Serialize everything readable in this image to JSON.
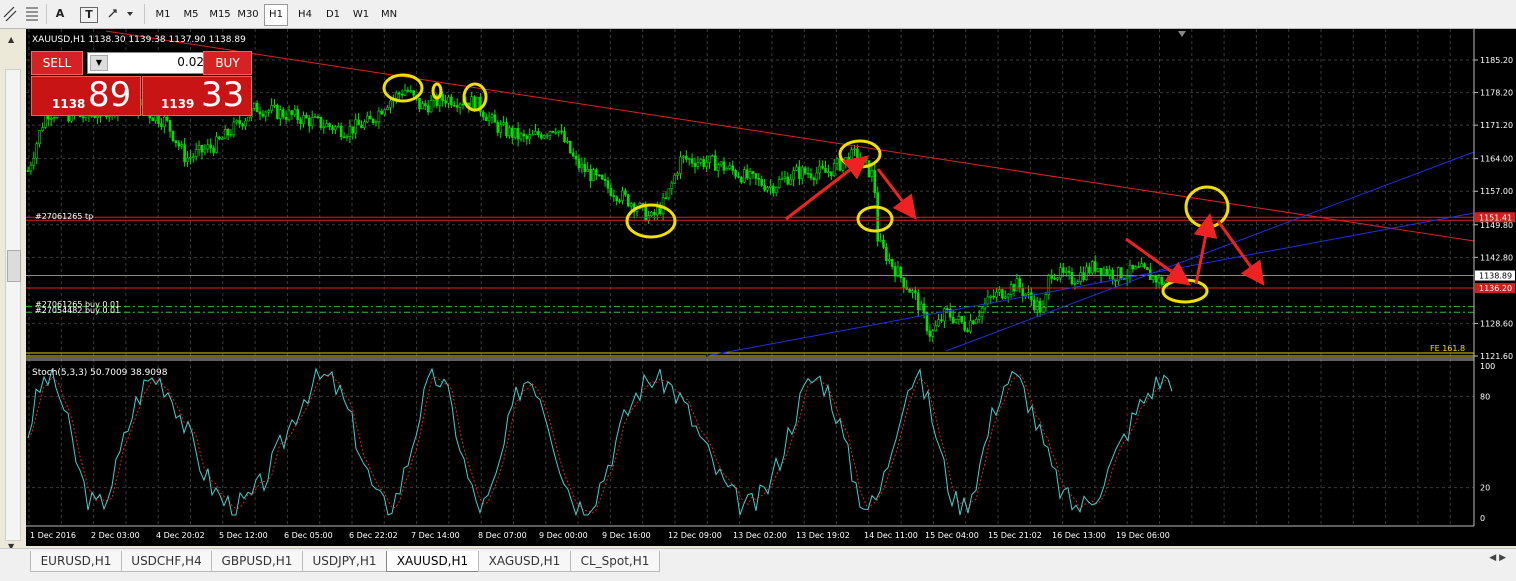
{
  "toolbar": {
    "tools": [
      "A",
      "T"
    ],
    "timeframes": [
      {
        "label": "M1",
        "active": false
      },
      {
        "label": "M5",
        "active": false
      },
      {
        "label": "M15",
        "active": false
      },
      {
        "label": "M30",
        "active": false
      },
      {
        "label": "H1",
        "active": true
      },
      {
        "label": "H4",
        "active": false
      },
      {
        "label": "D1",
        "active": false
      },
      {
        "label": "W1",
        "active": false
      },
      {
        "label": "MN",
        "active": false
      }
    ]
  },
  "chart": {
    "header": "XAUUSD,H1  1138.30 1139.38 1137.90 1138.89",
    "price_axis": [
      "1185.20",
      "1178.20",
      "1171.20",
      "1164.00",
      "1157.00",
      "1149.80",
      "1142.80",
      "1128.60",
      "1121.60"
    ],
    "price_badges": [
      {
        "label": "1151.41",
        "color": "#d02020"
      },
      {
        "label": "1138.89",
        "color": "#ffffff"
      },
      {
        "label": "1136.20",
        "color": "#d02020"
      }
    ],
    "order_labels": [
      "#27061265 tp",
      "#27061265 buy 0.01",
      "#27054482 buy 0.01"
    ],
    "fe_label": "FE 161.8",
    "stoch_header": "Stoch(5,3,3) 50.7009 38.9098",
    "stoch_axis": [
      "100",
      "80",
      "20",
      "0"
    ],
    "time_axis": [
      "1 Dec 2016",
      "2 Dec 03:00",
      "4 Dec 20:02",
      "5 Dec 12:00",
      "6 Dec 05:00",
      "6 Dec 22:02",
      "7 Dec 14:00",
      "8 Dec 07:00",
      "9 Dec 00:00",
      "9 Dec 16:00",
      "12 Dec 09:00",
      "13 Dec 02:00",
      "13 Dec 19:02",
      "14 Dec 11:00",
      "15 Dec 04:00",
      "15 Dec 21:02",
      "16 Dec 13:00",
      "19 Dec 06:00"
    ],
    "colors": {
      "bull": "#00e000",
      "bear": "#00e000",
      "trendline": "#e02020",
      "channel": "#2030e0",
      "annotation_circle": "#f0e000",
      "annotation_arrow": "#ee2222",
      "stoch_main": "#40d0d0",
      "stoch_signal": "#e02020"
    }
  },
  "trade_panel": {
    "sell_label": "SELL",
    "buy_label": "BUY",
    "lot": "0.02",
    "sell_small": "1138",
    "sell_big": "89",
    "buy_small": "1139",
    "buy_big": "33"
  },
  "tabs": [
    {
      "label": "EURUSD,H1",
      "active": false
    },
    {
      "label": "USDCHF,H4",
      "active": false
    },
    {
      "label": "GBPUSD,H1",
      "active": false
    },
    {
      "label": "USDJPY,H1",
      "active": false
    },
    {
      "label": "XAUUSD,H1",
      "active": true
    },
    {
      "label": "XAGUSD,H1",
      "active": false
    },
    {
      "label": "CL_Spot,H1",
      "active": false
    }
  ]
}
